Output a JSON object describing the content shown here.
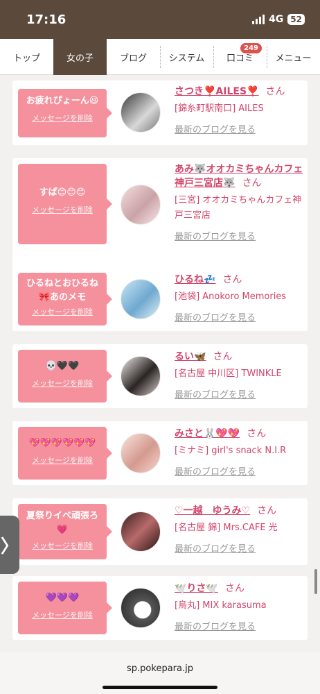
{
  "status": {
    "time": "17:16",
    "network": "4G",
    "battery": "52"
  },
  "nav": {
    "tabs": [
      {
        "label": "トップ"
      },
      {
        "label": "女の子"
      },
      {
        "label": "ブログ"
      },
      {
        "label": "システム"
      },
      {
        "label": "口コミ",
        "badge": "249"
      },
      {
        "label": "メニュー"
      }
    ]
  },
  "cards": [
    {
      "message": "お疲れぴょーん😆",
      "delete_label": "メッセージを削除",
      "name": "さつき❣️AILES❣️",
      "san": "さん",
      "shop": "[錦糸町駅南口] AILES",
      "blog_link": "最新のブログを見る"
    },
    {
      "message": "すぱ😊😊😊",
      "delete_label": "メッセージを削除",
      "name": "あみ🐺オオカミちゃんカフェ神戸三宮店🐺",
      "san": "さん",
      "shop": "[三宮] オオカミちゃんカフェ神戸三宮店",
      "blog_link": "最新のブログを見る"
    },
    {
      "message": "ひるねとおひるね🎀あのメモ",
      "delete_label": "メッセージを削除",
      "name": "ひるね💤",
      "san": "さん",
      "shop": "[池袋] Anokoro Memories",
      "blog_link": "最新のブログを見る"
    },
    {
      "message": "💀🖤🖤",
      "delete_label": "メッセージを削除",
      "name": "るい🦋",
      "san": "さん",
      "shop": "[名古屋 中川区] TWINKLE",
      "blog_link": "最新のブログを見る"
    },
    {
      "message": "💖💖💖💖💖💖",
      "delete_label": "メッセージを削除",
      "name": "みさと🐰💖💖",
      "san": "さん",
      "shop": "[ミナミ] girl's snack N.I.R",
      "blog_link": "最新のブログを見る"
    },
    {
      "message": "夏祭りイベ頑張ろ💗",
      "delete_label": "メッセージを削除",
      "name": "♡一越　ゆうみ♡",
      "san": "さん",
      "shop": "[名古屋 錦] Mrs.CAFE 光",
      "blog_link": "最新のブログを見る"
    },
    {
      "message": "💜💜💜",
      "delete_label": "メッセージを削除",
      "name": "🕊️りさ🕊️",
      "san": "さん",
      "shop": "[烏丸] MIX karasuma",
      "blog_link": "最新のブログを見る"
    }
  ],
  "side_tab": {
    "glyph": "〉"
  },
  "browser": {
    "url": "sp.pokepara.jp"
  },
  "colors": {
    "header": "#5b4a3c",
    "bubble": "#f5919d",
    "accent": "#d3456a",
    "badge": "#d9534f"
  }
}
